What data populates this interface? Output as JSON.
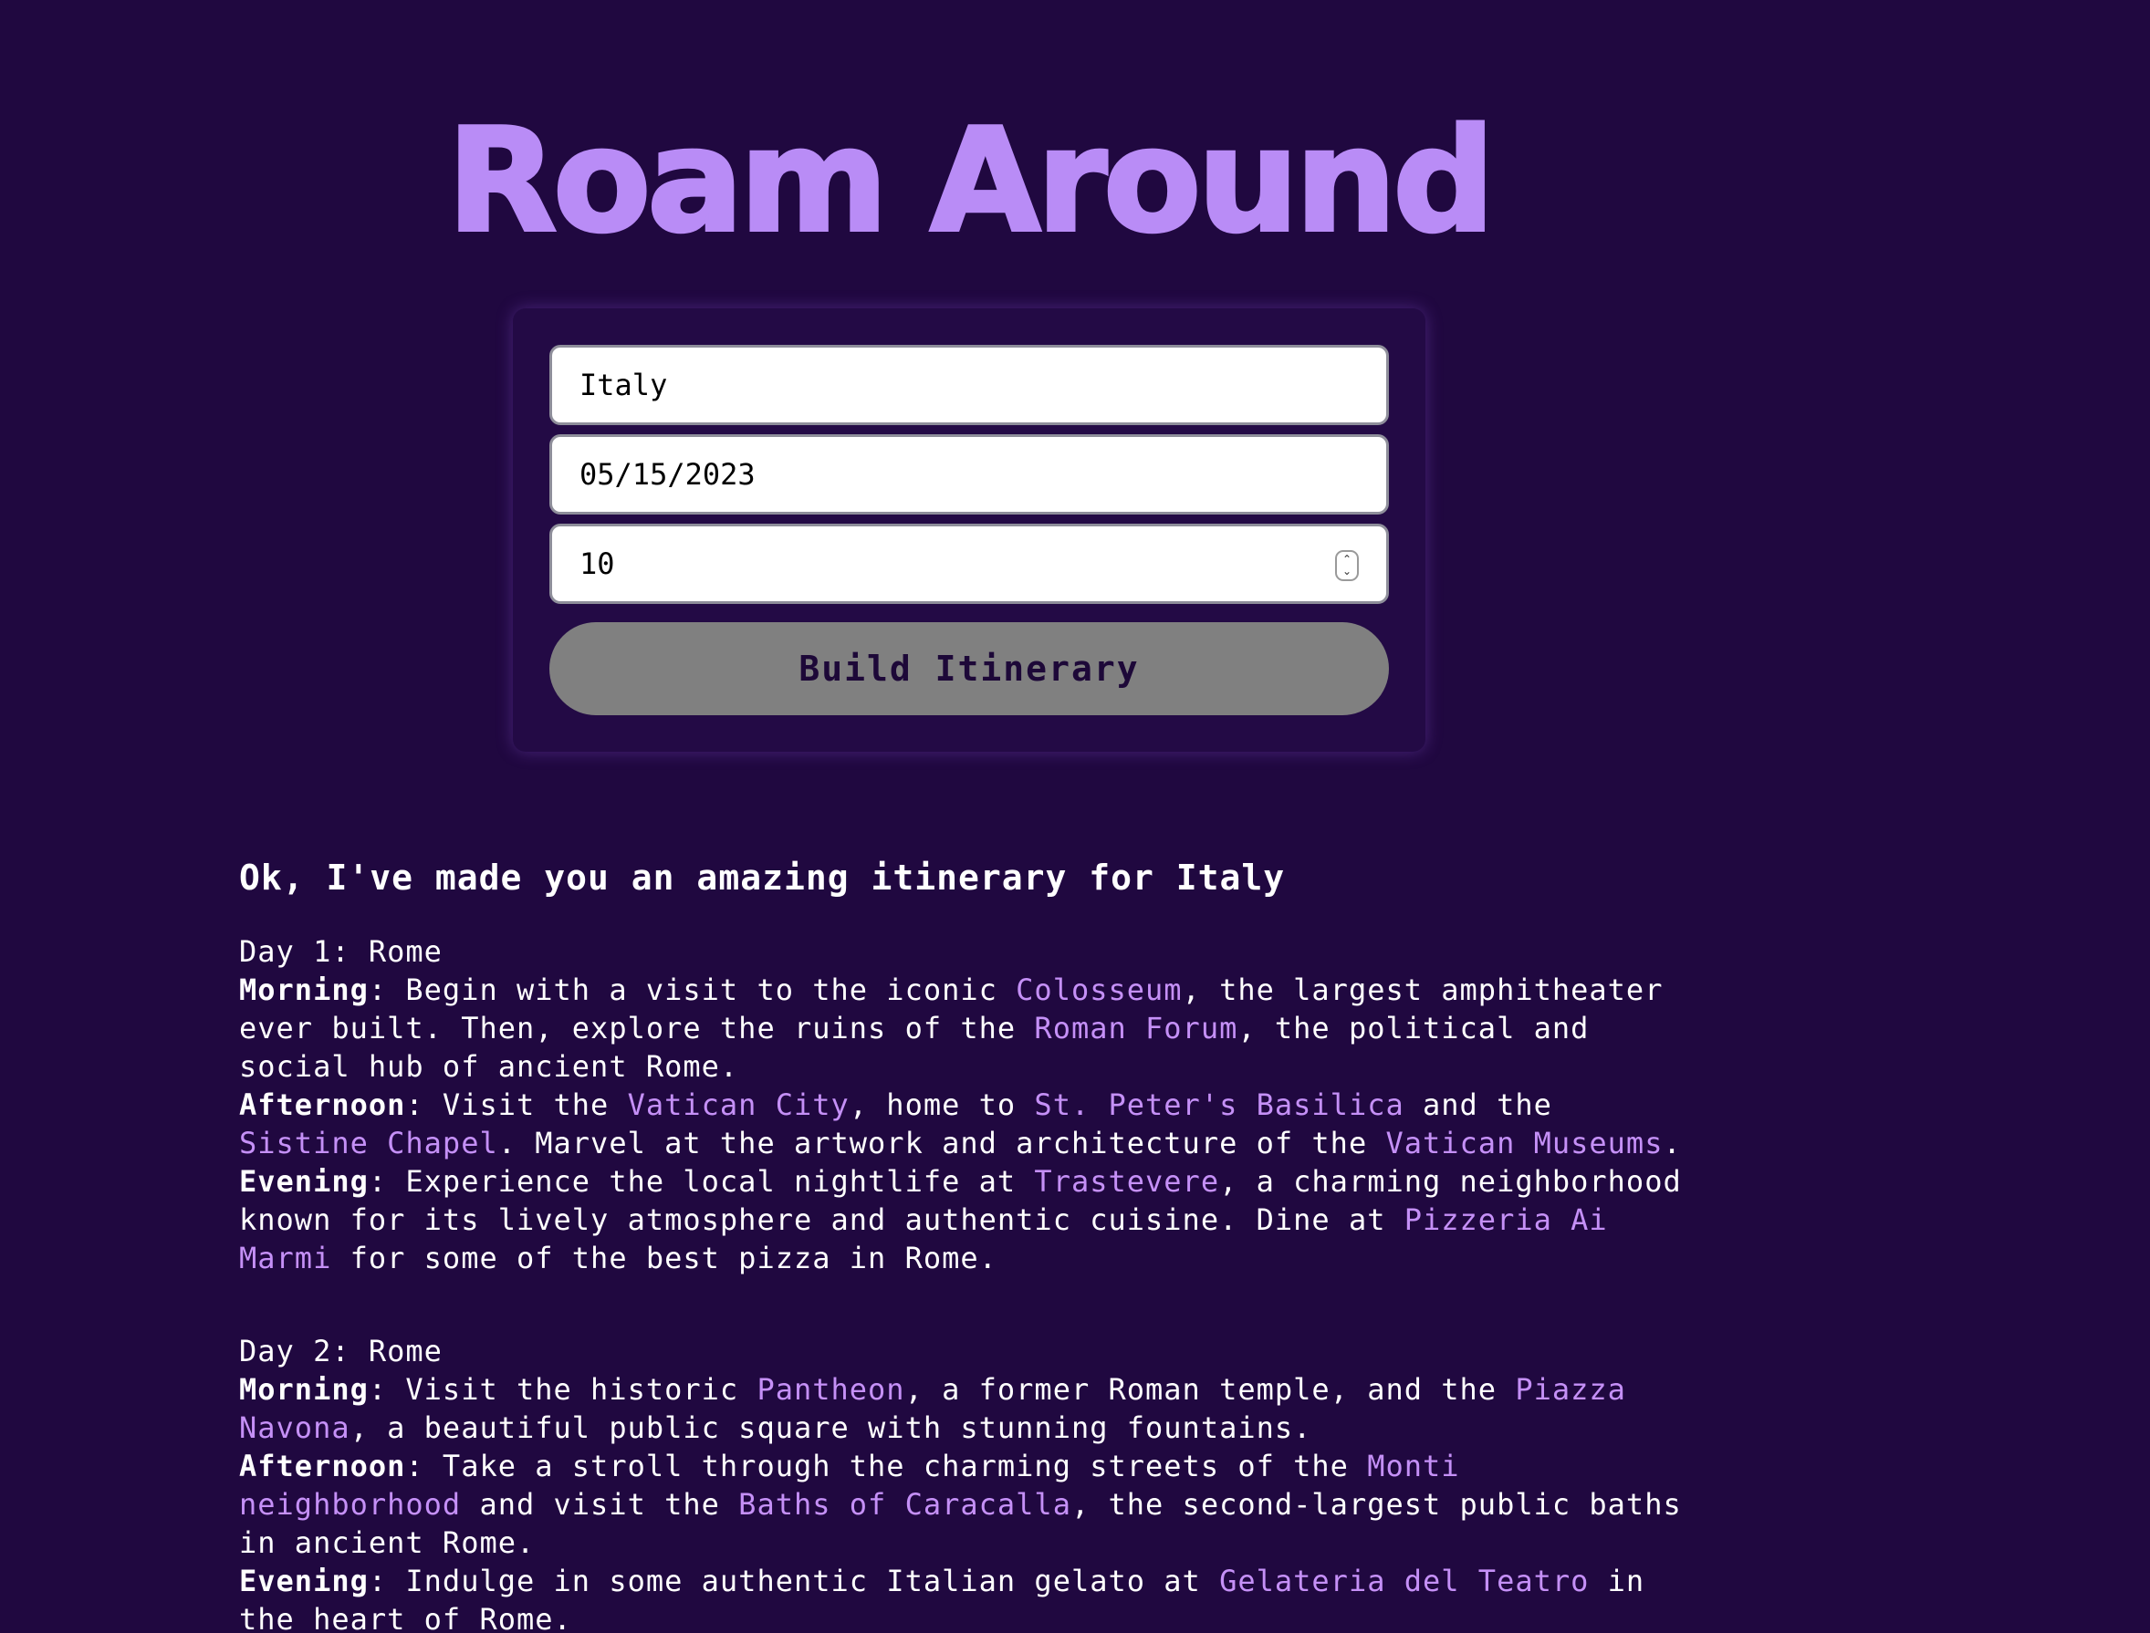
{
  "app": {
    "title": "Roam Around"
  },
  "form": {
    "destination_value": "Italy",
    "date_value": "05/15/2023",
    "days_value": "10",
    "spinner_up": "⌃",
    "spinner_down": "⌄",
    "submit_label": "Build Itinerary"
  },
  "itinerary": {
    "heading": "Ok, I've made you an amazing itinerary for Italy",
    "days": [
      {
        "title": "Day 1: Rome",
        "morning": {
          "label": "Morning",
          "t1": ": Begin with a visit to the iconic ",
          "p1": "Colosseum",
          "t2": ", the largest amphitheater ever built. Then, explore the ruins of the ",
          "p2": "Roman Forum",
          "t3": ", the political and social hub of ancient Rome."
        },
        "afternoon": {
          "label": "Afternoon",
          "t1": ": Visit the ",
          "p1": "Vatican City",
          "t2": ", home to ",
          "p2": "St. Peter's Basilica",
          "t3": " and the ",
          "p3": "Sistine Chapel",
          "t4": ". Marvel at the artwork and architecture of the ",
          "p4": "Vatican Museums",
          "t5": "."
        },
        "evening": {
          "label": "Evening",
          "t1": ": Experience the local nightlife at ",
          "p1": "Trastevere",
          "t2": ", a charming neighborhood known for its lively atmosphere and authentic cuisine. Dine at ",
          "p2": "Pizzeria Ai Marmi",
          "t3": " for some of the best pizza in Rome."
        }
      },
      {
        "title": "Day 2: Rome",
        "morning": {
          "label": "Morning",
          "t1": ": Visit the historic ",
          "p1": "Pantheon",
          "t2": ", a former Roman temple, and the ",
          "p2": "Piazza Navona",
          "t3": ", a beautiful public square with stunning fountains."
        },
        "afternoon": {
          "label": "Afternoon",
          "t1": ": Take a stroll through the charming streets of the ",
          "p1": "Monti neighborhood",
          "t2": " and visit the ",
          "p2": "Baths of Caracalla",
          "t3": ", the second-largest public baths in ancient Rome."
        },
        "evening": {
          "label": "Evening",
          "t1": ": Indulge in some authentic Italian gelato at ",
          "p1": "Gelateria del Teatro",
          "t2": " in the heart of Rome."
        }
      }
    ]
  },
  "colors": {
    "background": "#200840",
    "title_accent": "#b98cf6",
    "place_highlight": "#c590f7",
    "button_bg": "#808080"
  }
}
